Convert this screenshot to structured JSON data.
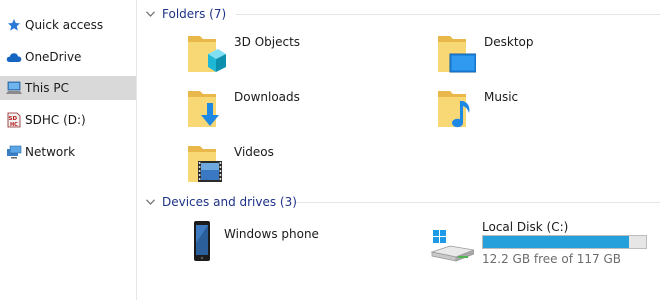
{
  "sidebar": {
    "items": [
      {
        "label": "Quick access",
        "icon": "star-icon"
      },
      {
        "label": "OneDrive",
        "icon": "cloud-icon"
      },
      {
        "label": "This PC",
        "icon": "computer-icon",
        "selected": true
      },
      {
        "label": "SDHC (D:)",
        "icon": "sd-card-icon"
      },
      {
        "label": "Network",
        "icon": "network-icon"
      }
    ]
  },
  "folders": {
    "header": "Folders (7)",
    "items": [
      {
        "label": "3D Objects",
        "icon": "3d-objects-folder-icon"
      },
      {
        "label": "Desktop",
        "icon": "desktop-folder-icon"
      },
      {
        "label": "Downloads",
        "icon": "downloads-folder-icon"
      },
      {
        "label": "Music",
        "icon": "music-folder-icon"
      },
      {
        "label": "Videos",
        "icon": "videos-folder-icon"
      }
    ]
  },
  "devices": {
    "header": "Devices and drives (3)",
    "phone": {
      "label": "Windows phone",
      "icon": "phone-icon"
    },
    "drive": {
      "label": "Local Disk (C:)",
      "icon": "windows-drive-icon",
      "free_text": "12.2 GB free of 117 GB",
      "used_fraction": 0.896
    }
  },
  "colors": {
    "accent_bar": "#26a0da",
    "group_header": "#1e3287",
    "folder_yellow": "#f8d775",
    "folder_dark": "#e8b94a",
    "selected_bg": "#d9d9d9"
  }
}
